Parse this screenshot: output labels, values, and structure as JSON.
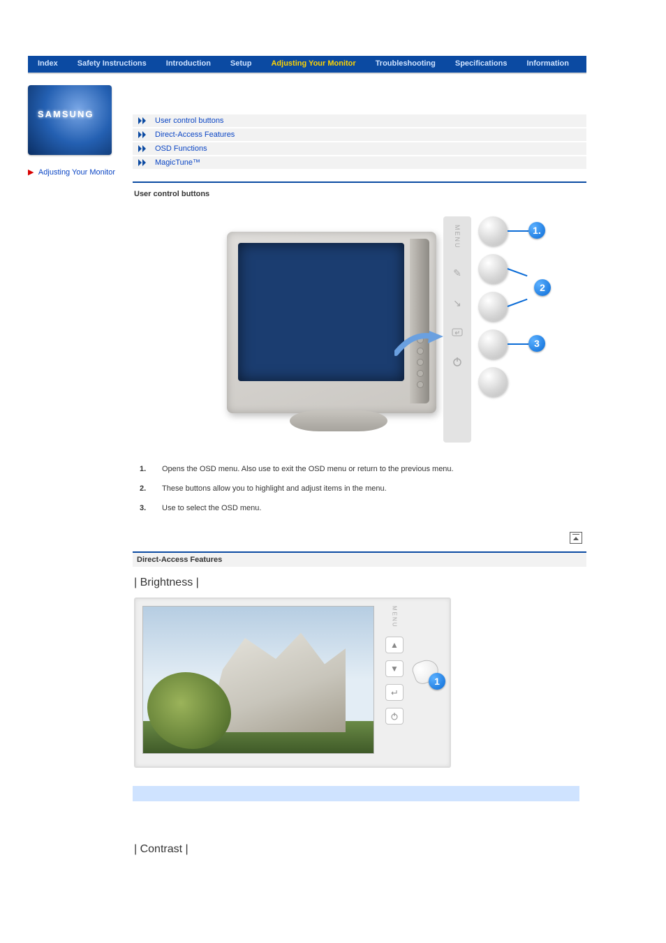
{
  "nav": {
    "items": [
      {
        "label": "Index",
        "active": false
      },
      {
        "label": "Safety Instructions",
        "active": false
      },
      {
        "label": "Introduction",
        "active": false
      },
      {
        "label": "Setup",
        "active": false
      },
      {
        "label": "Adjusting Your Monitor",
        "active": true
      },
      {
        "label": "Troubleshooting",
        "active": false
      },
      {
        "label": "Specifications",
        "active": false
      },
      {
        "label": "Information",
        "active": false
      }
    ]
  },
  "brand": "SAMSUNG",
  "sidebar": {
    "current_section": "Adjusting Your Monitor"
  },
  "links": [
    "User control buttons",
    "Direct-Access Features",
    "OSD Functions",
    "MagicTune™"
  ],
  "sections": {
    "user_control_buttons": {
      "title": "User control buttons",
      "panel_labels": {
        "menu": "MENU",
        "up_icon": "adjust-up",
        "down_icon": "adjust-down",
        "enter_icon": "enter",
        "power_icon": "power"
      },
      "items": [
        {
          "num": "1.",
          "text": "Opens the OSD menu. Also use to exit the OSD menu or return to the previous menu."
        },
        {
          "num": "2.",
          "text": "These buttons allow you to highlight and adjust items in the menu."
        },
        {
          "num": "3.",
          "text": "Use to select the OSD menu."
        }
      ]
    },
    "direct_access": {
      "title": "Direct-Access Features",
      "brightness": {
        "heading": "| Brightness |",
        "panel_labels": {
          "menu": "MENU",
          "up": "▲",
          "down": "▼",
          "enter_icon": "enter",
          "power_icon": "power"
        },
        "callout": "1"
      },
      "contrast": {
        "heading": "| Contrast |"
      }
    }
  }
}
